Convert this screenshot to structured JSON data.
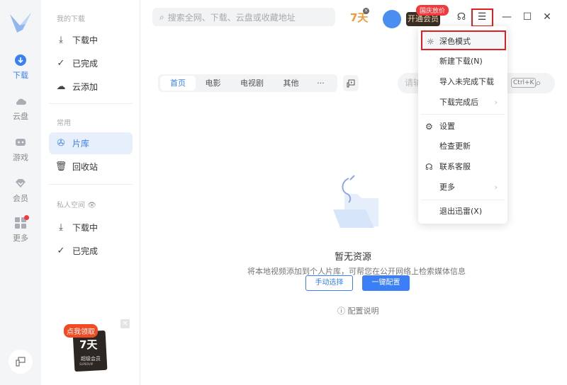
{
  "rail": {
    "items": [
      {
        "label": "下载",
        "active": true
      },
      {
        "label": "云盘"
      },
      {
        "label": "游戏"
      },
      {
        "label": "会员"
      },
      {
        "label": "更多",
        "badge": true
      }
    ]
  },
  "sidebar": {
    "sections": [
      {
        "title": "我的下载",
        "items": [
          {
            "label": "下载中",
            "icon": "download-icon"
          },
          {
            "label": "已完成",
            "icon": "check-circle-icon"
          },
          {
            "label": "云添加",
            "icon": "cloud-upload-icon"
          }
        ]
      },
      {
        "title": "常用",
        "items": [
          {
            "label": "片库",
            "icon": "film-reel-icon",
            "active": true
          },
          {
            "label": "回收站",
            "icon": "trash-icon"
          }
        ]
      },
      {
        "title": "私人空间",
        "items": [
          {
            "label": "下载中",
            "icon": "download-lock-icon"
          },
          {
            "label": "已完成",
            "icon": "check-lock-icon"
          }
        ]
      }
    ],
    "promo": {
      "tag": "点我领取",
      "days": "7天",
      "name": "超级会员",
      "sub": "SUPERVIP"
    }
  },
  "header": {
    "search_placeholder": "搜索全网、下载、云盘或收藏地址",
    "seven_days": "7天",
    "vip_button": "开通会员",
    "vip_tag": "国庆放价"
  },
  "library": {
    "tabs": [
      "首页",
      "电影",
      "电视剧",
      "其他",
      "···"
    ],
    "active_tab": "首页",
    "search_placeholder": "请输",
    "shortcut": "Ctrl+K",
    "empty_title": "暂无资源",
    "empty_desc": "将本地视频添加到个人片库，可帮您在公开网络上检索媒体信息",
    "manual_button": "手动选择",
    "auto_button": "一键配置",
    "help_link": "配置说明"
  },
  "menu": {
    "items": [
      "深色模式",
      "新建下载(N)",
      "导入未完成下载",
      "下载完成后",
      "设置",
      "检查更新",
      "联系客服",
      "更多",
      "退出迅雷(X)"
    ]
  },
  "colors": {
    "accent": "#3a7ff6",
    "highlight": "#e02020"
  }
}
